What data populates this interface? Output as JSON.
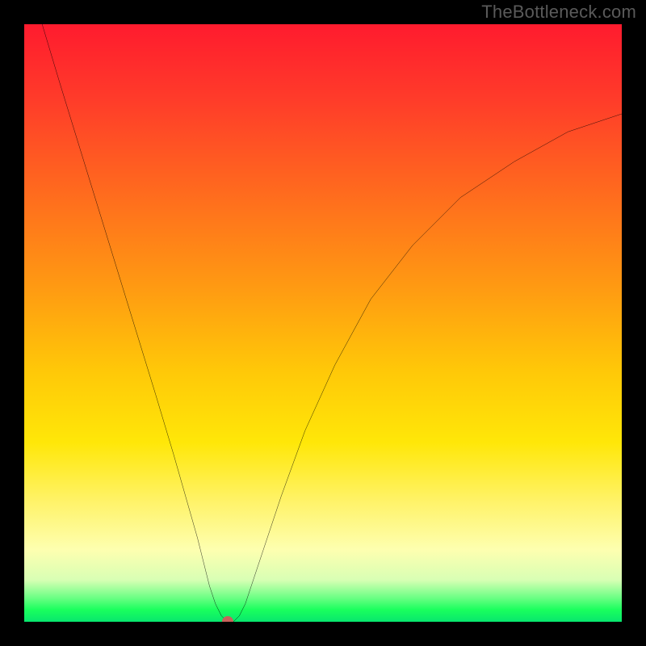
{
  "watermark": {
    "text": "TheBottleneck.com"
  },
  "colors": {
    "frame": "#000000",
    "curve": "#000000",
    "dot": "#c9625a",
    "gradient_stops": [
      "#ff1b2e",
      "#ff3a2a",
      "#ff6a1e",
      "#ff9a12",
      "#ffc808",
      "#ffe708",
      "#fff36a",
      "#fdffb0",
      "#d8ffb4",
      "#6bff84",
      "#1aff5d",
      "#08e66e"
    ]
  },
  "chart_data": {
    "type": "line",
    "title": "",
    "xlabel": "",
    "ylabel": "",
    "xlim": [
      0,
      100
    ],
    "ylim": [
      0,
      100
    ],
    "grid": false,
    "legend": null,
    "marker": {
      "x": 34,
      "y": 0
    },
    "series": [
      {
        "name": "curve",
        "x": [
          3,
          6,
          10,
          14,
          18,
          22,
          25,
          27,
          29,
          30,
          31,
          32,
          33,
          34,
          35,
          36,
          37,
          38,
          40,
          43,
          47,
          52,
          58,
          65,
          73,
          82,
          91,
          100
        ],
        "y": [
          100,
          90,
          77,
          64,
          51,
          38,
          28,
          21,
          14,
          10,
          6,
          3,
          1,
          0,
          0,
          1,
          3,
          6,
          12,
          21,
          32,
          43,
          54,
          63,
          71,
          77,
          82,
          85
        ]
      }
    ],
    "notes": "No tick labels or axes are visible; values are normalized 0–100 estimates read from the plot area. The curve has a sharp V-shaped minimum near x≈34, y≈0 where a small reddish dot sits. Left branch is nearly linear; right branch rises and flattens asymptotically."
  }
}
